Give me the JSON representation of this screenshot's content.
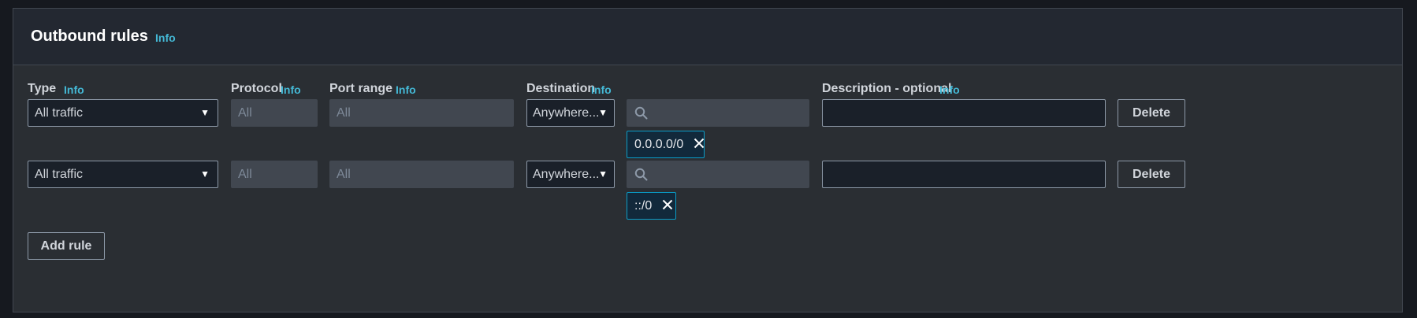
{
  "section": {
    "title": "Outbound rules",
    "info_label": "Info"
  },
  "columns": {
    "type": "Type",
    "protocol": "Protocol",
    "port_range": "Port range",
    "destination": "Destination",
    "description": "Description - optional",
    "info_label": "Info"
  },
  "rules": [
    {
      "type": "All traffic",
      "protocol": "All",
      "port_range": "All",
      "destination": "Anywhere...",
      "search_value": "",
      "cidr_token": "0.0.0.0/0",
      "description": "",
      "delete_label": "Delete"
    },
    {
      "type": "All traffic",
      "protocol": "All",
      "port_range": "All",
      "destination": "Anywhere...",
      "search_value": "",
      "cidr_token": "::/0",
      "description": "",
      "delete_label": "Delete"
    }
  ],
  "add_rule_label": "Add rule",
  "icons": {
    "dropdown": "caret-down-icon",
    "search": "search-icon",
    "remove": "close-icon"
  },
  "colors": {
    "info_link": "#44b9d6",
    "token_border": "#0a9cc6",
    "token_bg": "#12293b",
    "panel_bg": "#2a2e33",
    "header_bg": "#232831"
  }
}
